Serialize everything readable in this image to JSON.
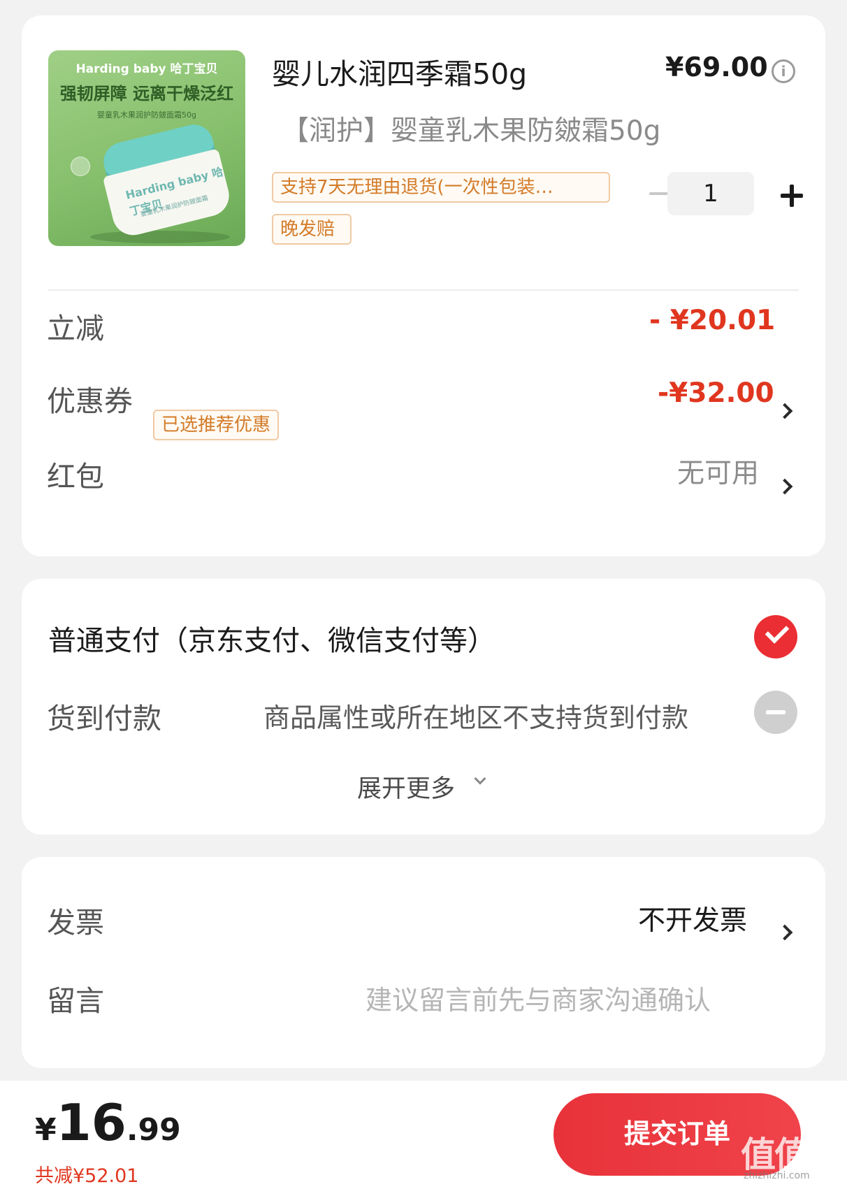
{
  "product": {
    "image": {
      "brand_text": "Harding baby 哈丁宝贝",
      "tagline": "强韧屏障 远离干燥泛红",
      "subline": "婴童乳木果润护防皴面霜50g",
      "jar_label": "Harding baby 哈丁宝贝",
      "jar_small_text": "婴童乳木果润护防皴面霜"
    },
    "title": "婴儿水润四季霜50g",
    "price": "¥69.00",
    "subtitle": "【润护】婴童乳木果防皴霜50g",
    "tags": [
      "支持7天无理由退货(一次性包装…",
      "晚发赔"
    ],
    "quantity": "1"
  },
  "discounts": {
    "instant_label": "立减",
    "instant_value": "- ¥20.01",
    "coupon_label": "优惠券",
    "coupon_badge": "已选推荐优惠",
    "coupon_value": "-¥32.00",
    "redpacket_label": "红包",
    "redpacket_value": "无可用"
  },
  "payment": {
    "normal_label": "普通支付（京东支付、微信支付等）",
    "cod_label": "货到付款",
    "cod_note": "商品属性或所在地区不支持货到付款",
    "expand_label": "展开更多"
  },
  "extra": {
    "invoice_label": "发票",
    "invoice_value": "不开发票",
    "message_label": "留言",
    "message_placeholder": "建议留言前先与商家沟通确认"
  },
  "footer": {
    "currency": "¥",
    "total_int": "16",
    "total_dec": ".99",
    "saved": "共减¥52.01",
    "submit_label": "提交订单"
  },
  "watermark": {
    "text": "值值值",
    "sub": "zhizhizhi.com"
  },
  "colors": {
    "accent_red": "#e0361f",
    "button_red": "#ea2e33",
    "tag_orange": "#d37b28",
    "page_bg": "#f2f2f2"
  }
}
